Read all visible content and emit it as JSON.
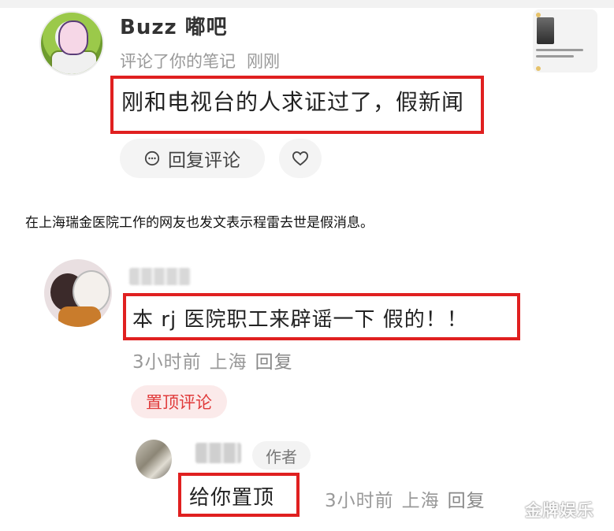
{
  "notification": {
    "username": "Buzz 嘟吧",
    "action": "评论了你的笔记",
    "time": "刚刚",
    "comment": "刚和电视台的人求证过了，假新闻",
    "reply_label": "回复评论",
    "icons": [
      "chat-bubble-icon",
      "heart-icon"
    ]
  },
  "caption": "在上海瑞金医院工作的网友也发文表示程雷去世是假消息。",
  "comment": {
    "text": "本 rj 医院职工来辟谣一下 假的！！",
    "time": "3小时前",
    "location": "上海",
    "reply_label": "回复",
    "pinned_label": "置顶评论"
  },
  "reply": {
    "author_badge": "作者",
    "text": "给你置顶",
    "time": "3小时前",
    "location": "上海",
    "reply_label": "回复"
  },
  "watermark": "金牌娱乐",
  "colors": {
    "highlight_red": "#e02020",
    "pinned_text": "#e03a3a",
    "meta_gray": "#999999"
  }
}
